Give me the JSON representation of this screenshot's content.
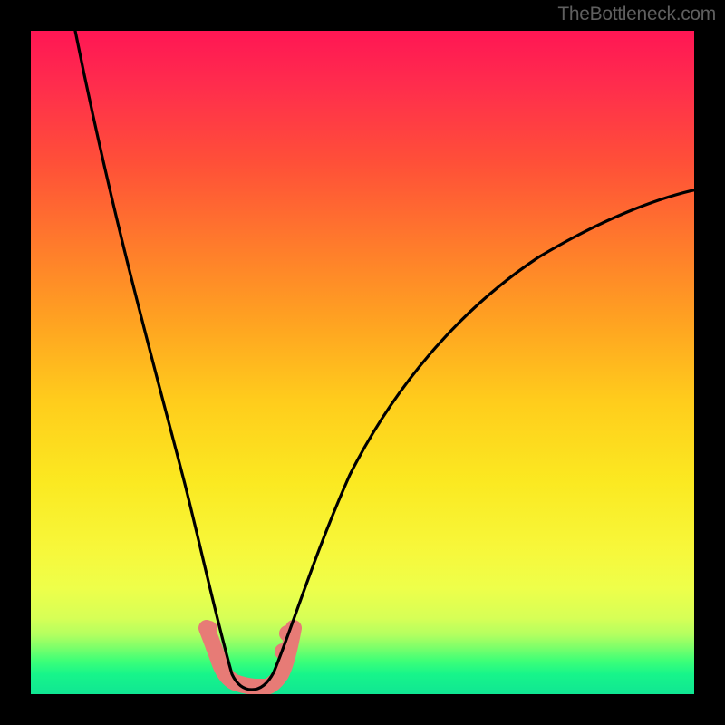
{
  "watermark": "TheBottleneck.com",
  "chart_data": {
    "type": "line",
    "title": "",
    "xlabel": "",
    "ylabel": "",
    "xlim": [
      0,
      100
    ],
    "ylim": [
      0,
      100
    ],
    "note": "Bottleneck-style V curve over red→yellow→green vertical gradient. Axes and ticks are hidden in source image; values are approximate percentages of the inner plot area.",
    "series": [
      {
        "name": "curve-left-branch",
        "x": [
          6.5,
          12,
          17,
          21,
          24,
          26.5,
          28.5,
          30,
          31
        ],
        "y": [
          100,
          72,
          50,
          32,
          18,
          9,
          4,
          1.5,
          0.7
        ]
      },
      {
        "name": "curve-right-branch",
        "x": [
          36,
          38,
          41,
          45,
          50,
          57,
          65,
          75,
          86,
          100
        ],
        "y": [
          0.7,
          2,
          6,
          14,
          25,
          38,
          50,
          61,
          69,
          76
        ]
      },
      {
        "name": "salmon-band",
        "x": [
          26.5,
          28.5,
          30,
          31,
          33.5,
          36,
          38,
          39.5
        ],
        "y": [
          10,
          4.5,
          2,
          1.2,
          1.2,
          1.4,
          4.8,
          10
        ]
      }
    ],
    "colors": {
      "curve": "#000000",
      "salmon_band": "#e77b76",
      "gradient_top": "#ff1654",
      "gradient_mid": "#fbe921",
      "gradient_bottom": "#10e693"
    }
  }
}
